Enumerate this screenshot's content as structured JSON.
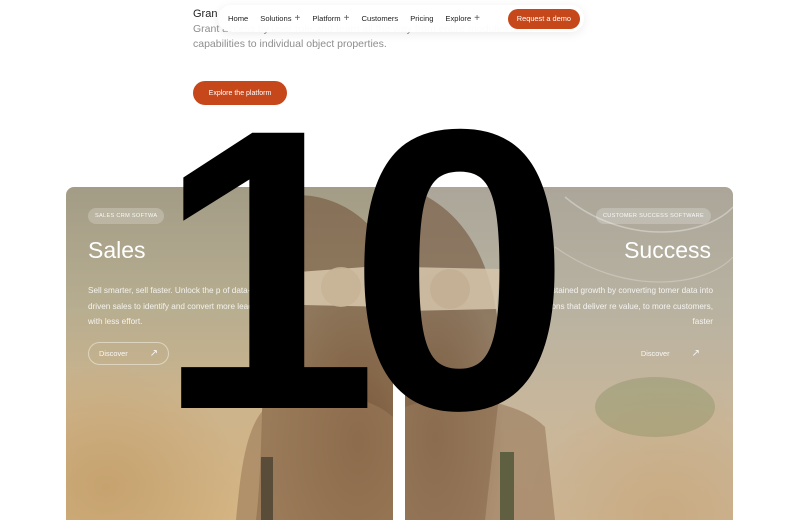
{
  "hero": {
    "heading": "Gran",
    "description": "Grant access by user role and team all the way from entire modules and capabilities to individual object properties."
  },
  "nav": {
    "items": [
      {
        "label": "Home",
        "has_plus": false
      },
      {
        "label": "Solutions",
        "has_plus": true
      },
      {
        "label": "Platform",
        "has_plus": true
      },
      {
        "label": "Customers",
        "has_plus": false
      },
      {
        "label": "Pricing",
        "has_plus": false
      },
      {
        "label": "Explore",
        "has_plus": true
      }
    ],
    "plus_symbol": "+",
    "cta_label": "Request a demo"
  },
  "explore_button": {
    "label": "Explore the platform"
  },
  "cards": [
    {
      "tag": "SALES CRM SOFTWA",
      "title": "Sales",
      "body": "Sell smarter, sell faster. Unlock the p of data-driven sales to identify and convert more leads with less effort.",
      "button_label": "Discover",
      "arrow": "↗"
    },
    {
      "tag": "CUSTOMER SUCCESS SOFTWARE",
      "title": "Success",
      "body": "sustained growth by converting tomer data into actions that deliver re value, to more customers, faster",
      "button_label": "Discover",
      "arrow": "↗"
    }
  ],
  "overlay": {
    "number": "10"
  },
  "colors": {
    "accent": "#c6471a",
    "overlay_text": "#000000"
  }
}
